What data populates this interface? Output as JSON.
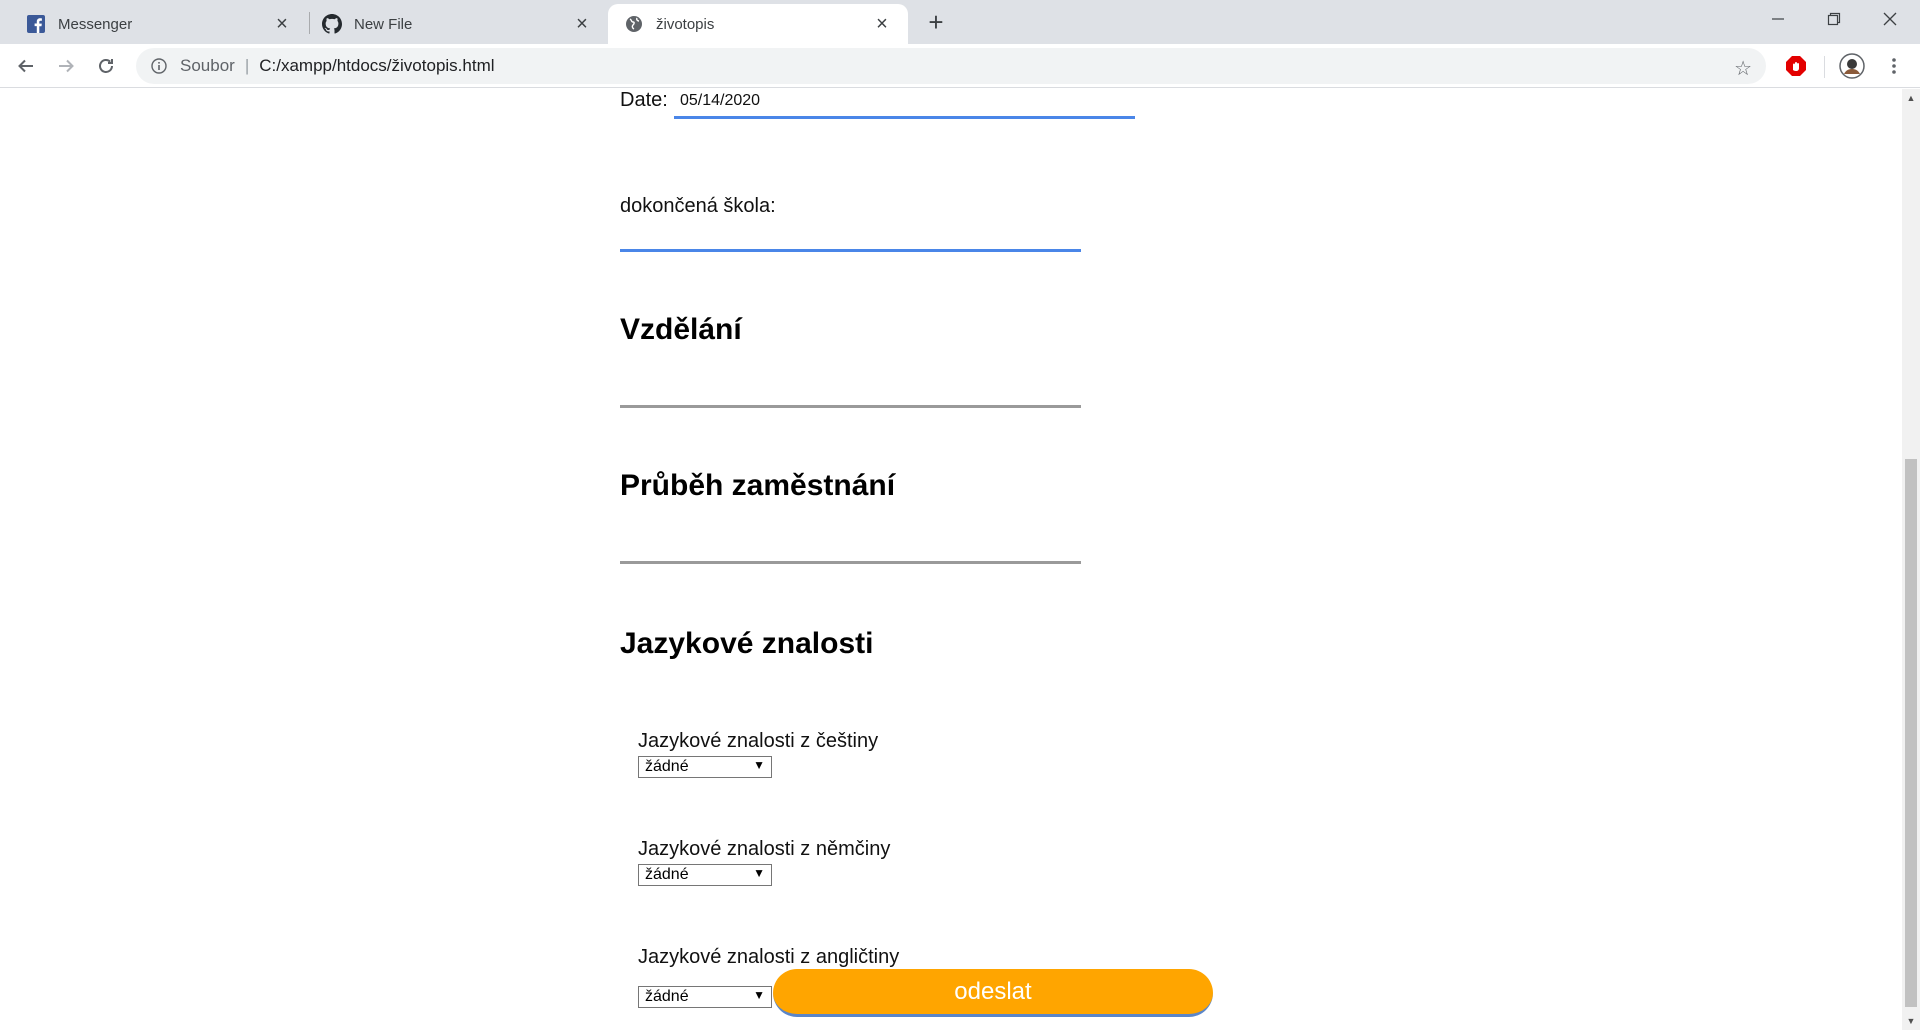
{
  "browser": {
    "tabs": [
      {
        "title": "Messenger",
        "icon": "facebook-icon"
      },
      {
        "title": "New File",
        "icon": "github-icon"
      },
      {
        "title": "životopis",
        "icon": "globe-icon"
      }
    ],
    "active_tab": 2,
    "address": {
      "scheme_label": "Soubor",
      "url": "C:/xampp/htdocs/životopis.html"
    }
  },
  "form": {
    "date_label": "Date:",
    "date_value": "05/14/2020",
    "school_label": "dokončená škola:",
    "sections": {
      "education": "Vzdělání",
      "employment": "Průběh zaměstnání",
      "languages": "Jazykové znalosti"
    },
    "languages": [
      {
        "label": "Jazykové znalosti z češtiny",
        "value": "žádné"
      },
      {
        "label": "Jazykové znalosti z němčiny",
        "value": "žádné"
      },
      {
        "label": "Jazykové znalosti z angličtiny",
        "value": "žádné"
      }
    ],
    "submit_label": "odeslat"
  },
  "colors": {
    "accent_underline": "#4a86e8",
    "submit_bg": "#ffa500",
    "tab_strip": "#dee1e6"
  }
}
